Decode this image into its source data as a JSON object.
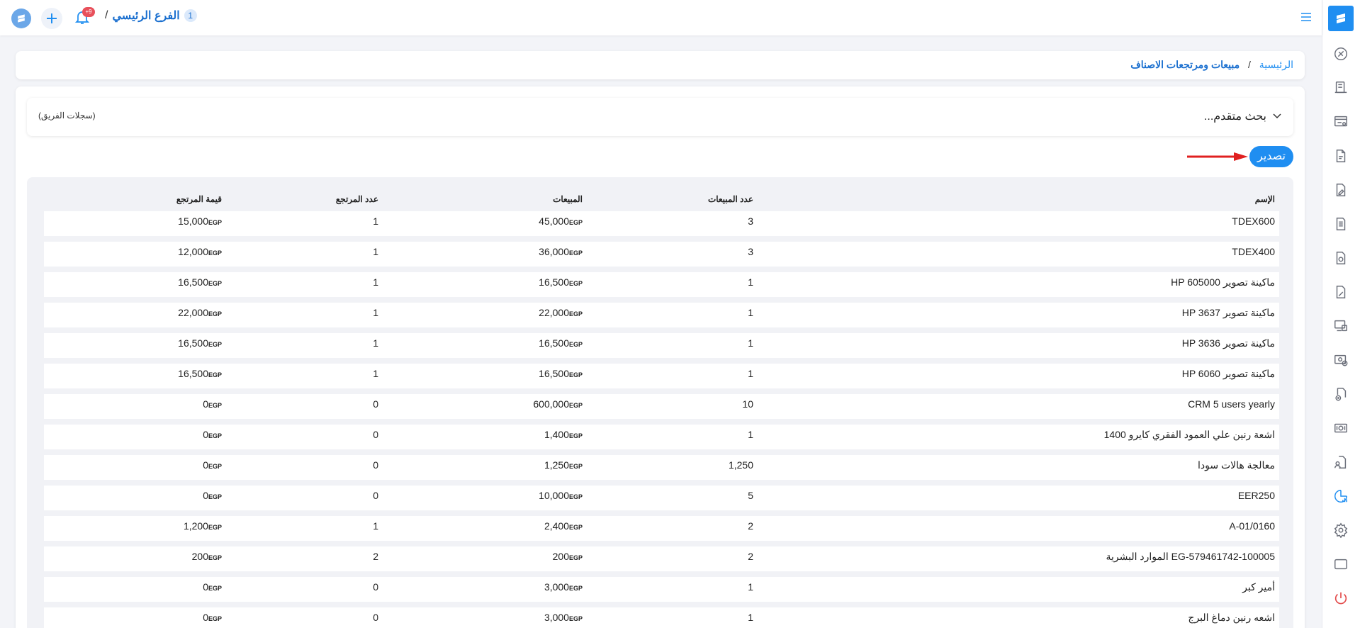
{
  "topbar": {
    "branch_name": "الفرع الرئيسي",
    "branch_number": "1",
    "separator": "/",
    "notification_badge": "+9"
  },
  "breadcrumb": {
    "home": "الرئيسية",
    "separator": "/",
    "current": "مبيعات ومرتجعات الاصناف"
  },
  "search": {
    "title": "بحث متقدم...",
    "team_records": "(سجلات الفريق)"
  },
  "actions": {
    "export_label": "تصدير"
  },
  "colors": {
    "accent": "#1f8ef1",
    "arrow": "#e02020",
    "danger": "#e34b4b"
  },
  "sidebar": {
    "icons": [
      "dashboard-icon",
      "pos-icon",
      "invoice-icon",
      "document-icon",
      "document-edit-icon",
      "file-list-icon",
      "contract-icon",
      "contract-edit-icon",
      "screen-pos-icon",
      "money-add-icon",
      "document-add-icon",
      "cash-icon",
      "file-user-icon",
      "report-chart-icon",
      "gear-icon",
      "window-icon",
      "power-icon"
    ]
  },
  "table": {
    "headers": {
      "name": "الإسم",
      "sales_count": "عدد المبيعات",
      "sales": "المبيعات",
      "returns_count": "عدد المرتجع",
      "returns_value": "قيمة المرتجع"
    },
    "currency": "EGP",
    "rows": [
      {
        "name": "TDEX600",
        "sales_count": "3",
        "sales": "45,000",
        "returns_count": "1",
        "returns_value": "15,000"
      },
      {
        "name": "TDEX400",
        "sales_count": "3",
        "sales": "36,000",
        "returns_count": "1",
        "returns_value": "12,000"
      },
      {
        "name": "ماكينة تصوير HP 605000",
        "sales_count": "1",
        "sales": "16,500",
        "returns_count": "1",
        "returns_value": "16,500"
      },
      {
        "name": "ماكينة تصوير HP 3637",
        "sales_count": "1",
        "sales": "22,000",
        "returns_count": "1",
        "returns_value": "22,000"
      },
      {
        "name": "ماكينة تصوير HP 3636",
        "sales_count": "1",
        "sales": "16,500",
        "returns_count": "1",
        "returns_value": "16,500"
      },
      {
        "name": "ماكينة تصوير HP 6060",
        "sales_count": "1",
        "sales": "16,500",
        "returns_count": "1",
        "returns_value": "16,500"
      },
      {
        "name": "CRM 5 users yearly",
        "sales_count": "10",
        "sales": "600,000",
        "returns_count": "0",
        "returns_value": "0"
      },
      {
        "name": "اشعة رنين علي العمود الفقري كايرو 1400",
        "sales_count": "1",
        "sales": "1,400",
        "returns_count": "0",
        "returns_value": "0"
      },
      {
        "name": "معالجة هالات سودا",
        "sales_count": "1,250",
        "sales": "1,250",
        "returns_count": "0",
        "returns_value": "0"
      },
      {
        "name": "EER250",
        "sales_count": "5",
        "sales": "10,000",
        "returns_count": "0",
        "returns_value": "0"
      },
      {
        "name": "A-01/0160",
        "sales_count": "2",
        "sales": "2,400",
        "returns_count": "1",
        "returns_value": "1,200"
      },
      {
        "name": "EG-579461742-100005 الموارد البشرية",
        "sales_count": "2",
        "sales": "200",
        "returns_count": "2",
        "returns_value": "200"
      },
      {
        "name": "أمير كبر",
        "sales_count": "1",
        "sales": "3,000",
        "returns_count": "0",
        "returns_value": "0"
      },
      {
        "name": "اشعه رنين دماغ البرج",
        "sales_count": "1",
        "sales": "3,000",
        "returns_count": "0",
        "returns_value": "0"
      }
    ]
  }
}
